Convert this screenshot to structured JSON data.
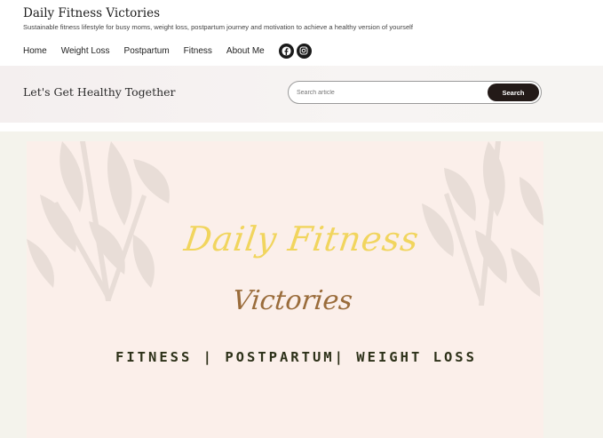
{
  "site": {
    "title": "Daily Fitness Victories",
    "tagline": "Sustainable fitness lifestyle for busy moms, weight loss, postpartum journey and motivation to achieve a healthy version of yourself"
  },
  "nav": {
    "items": [
      {
        "label": "Home"
      },
      {
        "label": "Weight Loss"
      },
      {
        "label": "Postpartum"
      },
      {
        "label": "Fitness"
      },
      {
        "label": "About Me"
      }
    ],
    "social": [
      {
        "icon": "facebook-icon"
      },
      {
        "icon": "instagram-icon"
      }
    ]
  },
  "band": {
    "title": "Let's Get Healthy Together",
    "search": {
      "placeholder": "Search article",
      "button_label": "Search"
    }
  },
  "banner": {
    "line1": "Daily Fitness",
    "line2": "Victories",
    "line3": "FITNESS | POSTPARTUM| WEIGHT LOSS"
  },
  "colors": {
    "banner_bg": "#fbefea",
    "title_yellow": "#f1d55e",
    "title_brown": "#9a6c3b",
    "tagline_dark": "#2d3119",
    "search_button": "#231a18"
  }
}
